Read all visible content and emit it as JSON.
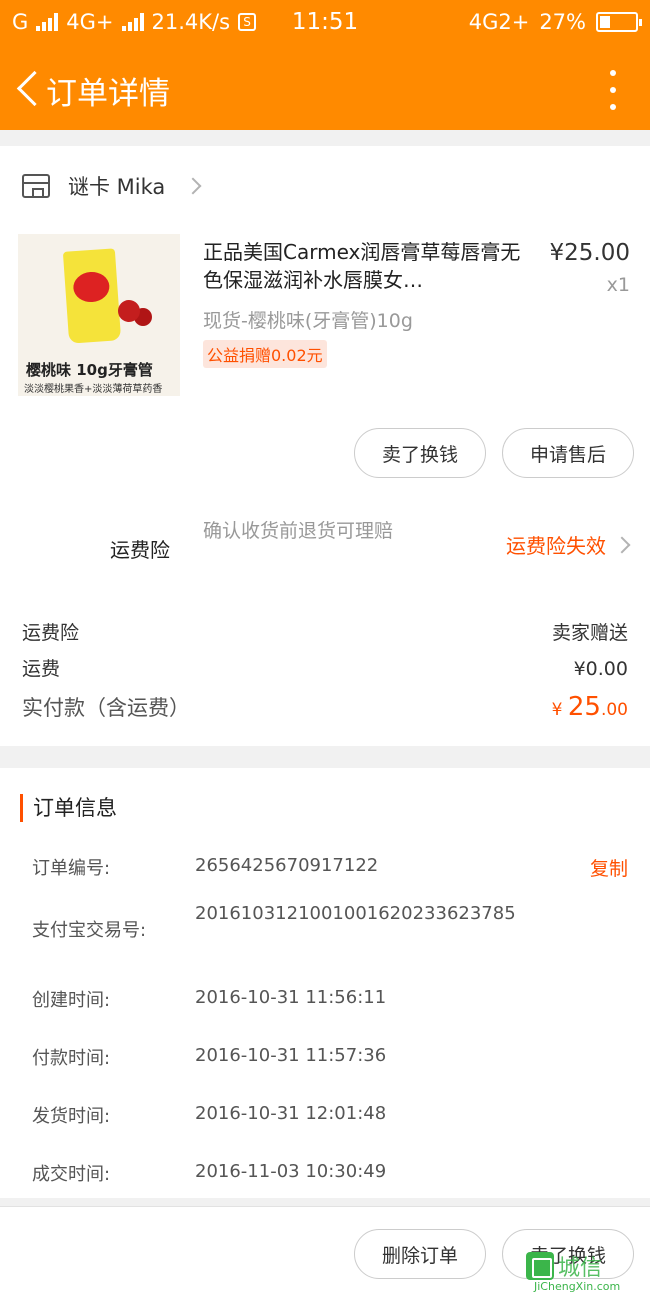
{
  "status_bar": {
    "carrier": "G",
    "network": "4G+",
    "speed": "21.4K/s",
    "s_badge": "S",
    "time": "11:51",
    "network_right": "4G2+",
    "battery": "27%"
  },
  "header": {
    "title": "订单详情",
    "back_icon": "chevron-left-icon",
    "more_icon": "more-vertical-icon"
  },
  "shop": {
    "name": "谜卡 Mika",
    "icon": "store-icon"
  },
  "product": {
    "name": "正品美国Carmex润唇膏草莓唇膏无色保湿滋润补水唇膜女…",
    "price": "¥25.00",
    "quantity": "x1",
    "sku": "现货-樱桃味(牙膏管)10g",
    "tag": "公益捐赠0.02元",
    "thumbnail_text_1": "樱桃味 10g牙膏管",
    "thumbnail_text_2": "淡淡樱桃果香+淡淡薄荷草药香"
  },
  "actions": {
    "sell_label": "卖了换钱",
    "after_sale_label": "申请售后"
  },
  "shipping_insurance": {
    "label": "运费险",
    "description": "确认收货前退货可理赔",
    "status": "运费险失效"
  },
  "costs": [
    {
      "label": "运费险",
      "value": "卖家赠送"
    },
    {
      "label": "运费",
      "value": "¥0.00"
    }
  ],
  "total": {
    "label": "实付款（含运费）",
    "currency": "¥",
    "integer": "25",
    "decimal": ".00"
  },
  "order_info": {
    "title": "订单信息",
    "copy_label": "复制",
    "rows": [
      {
        "key": "订单编号:",
        "value": "2656425670917122"
      },
      {
        "key": "支付宝交易号:",
        "value": "2016103121001001620233623785"
      },
      {
        "key": "创建时间:",
        "value": "2016-10-31 11:56:11"
      },
      {
        "key": "付款时间:",
        "value": "2016-10-31 11:57:36"
      },
      {
        "key": "发货时间:",
        "value": "2016-10-31 12:01:48"
      },
      {
        "key": "成交时间:",
        "value": "2016-11-03 10:30:49"
      }
    ]
  },
  "bottom_bar": {
    "delete_label": "删除订单",
    "sell_label": "卖了换钱"
  },
  "watermark": {
    "cn": "城信",
    "en": "JiChengXin.com"
  },
  "colors": {
    "brand": "#ff8a00",
    "accent": "#ff5000"
  }
}
